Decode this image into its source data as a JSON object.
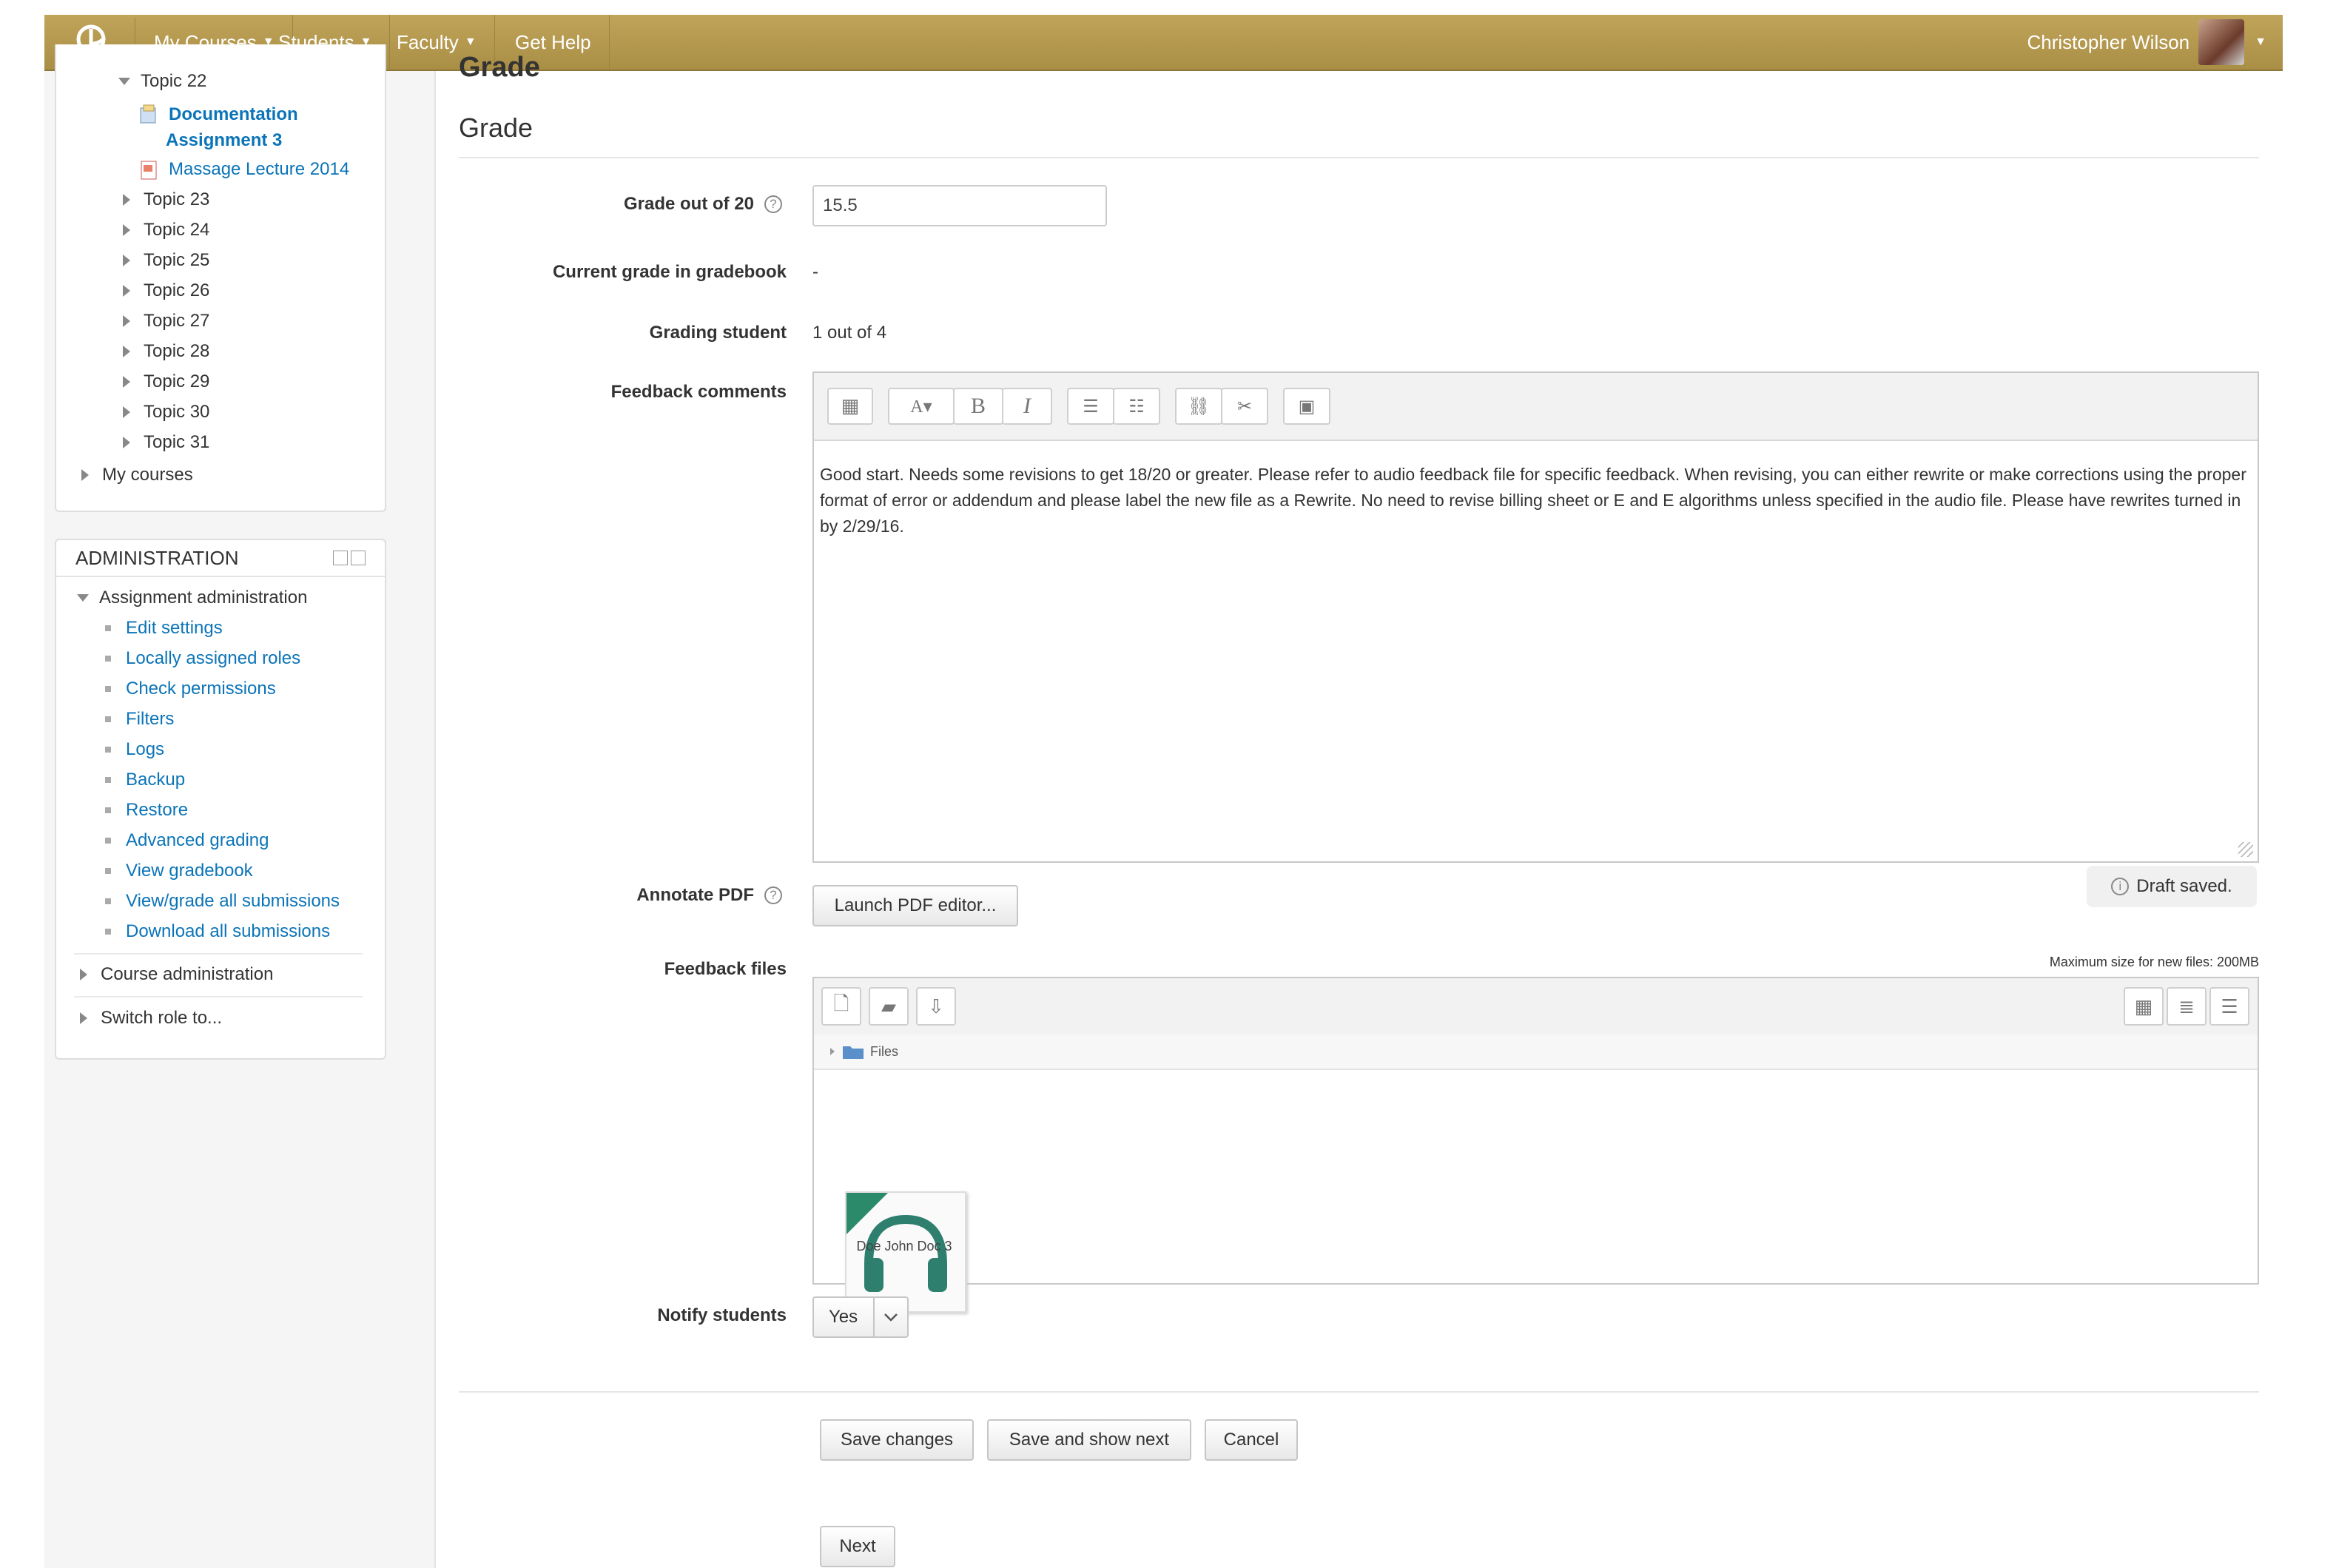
{
  "nav": {
    "items": [
      {
        "label": "My Courses"
      },
      {
        "label": "Students"
      },
      {
        "label": "Faculty"
      },
      {
        "label": "Get Help"
      }
    ],
    "user_name": "Christopher Wilson"
  },
  "sidebar": {
    "topic22": "Topic 22",
    "doc_link_line1": "Documentation",
    "doc_link_line2": "Assignment 3",
    "massage_link": "Massage Lecture 2014",
    "topics": [
      "Topic 23",
      "Topic 24",
      "Topic 25",
      "Topic 26",
      "Topic 27",
      "Topic 28",
      "Topic 29",
      "Topic 30",
      "Topic 31"
    ],
    "my_courses": "My courses"
  },
  "admin": {
    "title": "ADMINISTRATION",
    "assignment_admin": "Assignment administration",
    "links": [
      "Edit settings",
      "Locally assigned roles",
      "Check permissions",
      "Filters",
      "Logs",
      "Backup",
      "Restore",
      "Advanced grading",
      "View gradebook",
      "View/grade all submissions",
      "Download all submissions"
    ],
    "course_admin": "Course administration",
    "switch_role": "Switch role to..."
  },
  "main": {
    "heading_top": "Grade",
    "heading": "Grade",
    "grade_label": "Grade out of 20",
    "grade_value": "15.5",
    "current_grade_label": "Current grade in gradebook",
    "current_grade_value": "-",
    "grading_student_label": "Grading student",
    "grading_student_value": "1 out of 4",
    "feedback_label": "Feedback comments",
    "feedback_text": "Good start.  Needs some revisions to get 18/20 or greater.  Please refer to audio feedback file for specific feedback.  When revising, you can either rewrite or make corrections using the proper format of error or addendum and please label the new file as a Rewrite.  No need to revise billing sheet or E and E algorithms unless specified in the audio file.  Please have rewrites turned in by 2/29/16.",
    "draft_saved": "Draft saved.",
    "annotate_label": "Annotate PDF",
    "launch_pdf": "Launch PDF editor...",
    "feedback_files_label": "Feedback files",
    "max_size": "Maximum size for new files: 200MB",
    "files_path": "Files",
    "file_name": "Doe John Doc 3",
    "notify_label": "Notify students",
    "notify_value": "Yes",
    "save_changes": "Save changes",
    "save_next": "Save and show next",
    "cancel": "Cancel",
    "next": "Next"
  }
}
